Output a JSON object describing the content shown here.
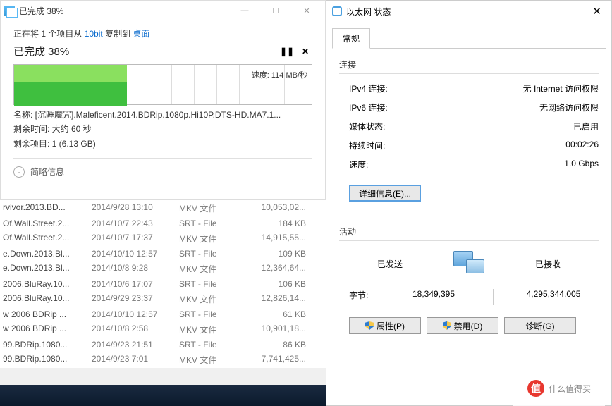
{
  "copyDialog": {
    "title": "已完成 38%",
    "copying": "正在将 1 个项目从",
    "src": "10bit",
    "mid": "复制到",
    "dst": "桌面",
    "progressLabel": "已完成 38%",
    "speed": "速度: 114 MB/秒",
    "nameLabel": "名称: [沉睡魔咒].Maleficent.2014.BDRip.1080p.Hi10P.DTS-HD.MA7.1...",
    "remainTime": "剩余时间: 大约 60 秒",
    "remainItems": "剩余项目: 1 (6.13 GB)",
    "brief": "简略信息"
  },
  "files": [
    {
      "name": "rvivor.2013.BD...",
      "date": "2014/9/28 13:10",
      "type": "MKV 文件",
      "size": "10,053,02..."
    },
    {
      "name": "Of.Wall.Street.2...",
      "date": "2014/10/7 22:43",
      "type": "SRT - File",
      "size": "184 KB"
    },
    {
      "name": "Of.Wall.Street.2...",
      "date": "2014/10/7 17:37",
      "type": "MKV 文件",
      "size": "14,915,55..."
    },
    {
      "name": "e.Down.2013.Bl...",
      "date": "2014/10/10 12:57",
      "type": "SRT - File",
      "size": "109 KB"
    },
    {
      "name": "e.Down.2013.Bl...",
      "date": "2014/10/8 9:28",
      "type": "MKV 文件",
      "size": "12,364,64..."
    },
    {
      "name": "2006.BluRay.10...",
      "date": "2014/10/6 17:07",
      "type": "SRT - File",
      "size": "106 KB"
    },
    {
      "name": "2006.BluRay.10...",
      "date": "2014/9/29 23:37",
      "type": "MKV 文件",
      "size": "12,826,14..."
    },
    {
      "name": "w 2006 BDRip ...",
      "date": "2014/10/10 12:57",
      "type": "SRT - File",
      "size": "61 KB"
    },
    {
      "name": "w 2006 BDRip ...",
      "date": "2014/10/8 2:58",
      "type": "MKV 文件",
      "size": "10,901,18..."
    },
    {
      "name": "99.BDRip.1080...",
      "date": "2014/9/23 21:51",
      "type": "SRT - File",
      "size": "86 KB"
    },
    {
      "name": "99.BDRip.1080...",
      "date": "2014/9/23 7:01",
      "type": "MKV 文件",
      "size": "7,741,425..."
    }
  ],
  "eth": {
    "title": "以太网 状态",
    "tab": "常规",
    "connection": "连接",
    "rows": {
      "ipv4k": "IPv4 连接:",
      "ipv4v": "无 Internet 访问权限",
      "ipv6k": "IPv6 连接:",
      "ipv6v": "无网络访问权限",
      "mediak": "媒体状态:",
      "mediav": "已启用",
      "durk": "持续时间:",
      "durv": "00:02:26",
      "spdk": "速度:",
      "spdv": "1.0 Gbps"
    },
    "details": "详细信息(E)...",
    "activity": "活动",
    "sentLabel": "已发送",
    "recvLabel": "已接收",
    "bytesLabel": "字节:",
    "sent": "18,349,395",
    "recv": "4,295,344,005",
    "btnProp": "属性(P)",
    "btnDisable": "禁用(D)",
    "btnDiag": "诊断(G)"
  },
  "watermark": "什么值得买"
}
